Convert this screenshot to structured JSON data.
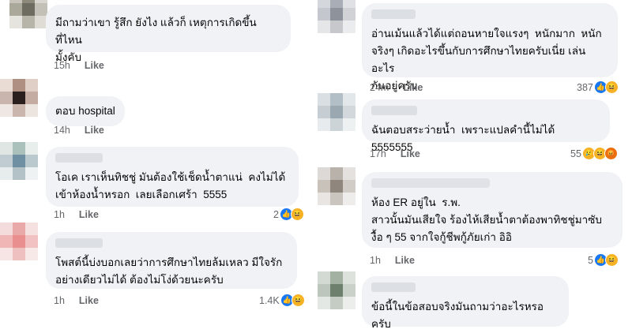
{
  "colors": {
    "bubble": "#f0f2f5",
    "meta": "#65676b",
    "like_reaction": "#1877f2",
    "haha_reaction": "#f7b125",
    "angry_reaction": "#e9710f"
  },
  "left": {
    "c1": {
      "text": "มีถามว่าเขา รู้สึก ยังไง แล้วก็ เหตุการเกิดขึ้นที่ไหน\nมั้งคับ",
      "time": "15h",
      "like": "Like"
    },
    "c2": {
      "text": "ตอบ hospital",
      "time": "14h",
      "like": "Like"
    },
    "c3": {
      "text": "โอเค เราเห็นทิชชู่ มันต้องใช้เช็ดน้ำตาแน่  คงไม่ได้\nเข้าห้องน้ำหรอก  เลยเลือกเศร้า  5555",
      "time": "1h",
      "like": "Like",
      "reactions": "2",
      "icons": [
        "like-icon",
        "haha-icon"
      ]
    },
    "c4": {
      "text": "โพสต์นี้บ่งบอกเลยว่าการศึกษาไทยล้มเหลว มีใจรัก\nอย่างเดียวไม่ได้ ต้องไม่โง่ด้วยนะครับ",
      "time": "1h",
      "like": "Like",
      "reactions": "1.4K",
      "icons": [
        "like-icon",
        "haha-icon"
      ]
    }
  },
  "right": {
    "c1": {
      "text": "อ่านเม้นแล้วได้แต่ถอนหายใจแรงๆ  หนักมาก  หนัก\nจริงๆ เกิดอะไรขึ้นกับการศึกษาไทยครับเนี่ย เล่นอะไร\nกันอยู่ครับ",
      "time": "24m",
      "like": "Like",
      "reactions": "387",
      "icons": [
        "like-icon",
        "haha-icon"
      ]
    },
    "c2": {
      "text": "ฉันตอบสระว่ายน้ำ  เพราะแปลคำนี้ไม่ได้  5555555",
      "time": "17h",
      "like": "Like",
      "reactions": "55",
      "icons": [
        "sad-icon",
        "haha-icon",
        "angry-icon"
      ]
    },
    "c3": {
      "text": "ห้อง ER อยู่ใน  ร.พ.\nสาวนั้นมันเสียใจ ร้องไห้เสียน้ำตาต้องพาทิชชู่มาซับ\nงื้อ ๆ 55 จากใจกู้ชีพกู้ภัยเก่า อิอิ",
      "time": "1h",
      "like": "Like",
      "reactions": "5",
      "icons": [
        "like-icon",
        "haha-icon"
      ]
    },
    "c4": {
      "text": "ข้อนี้ในข้อสอบจริงมันถามว่าอะไรหรอครับ"
    }
  }
}
